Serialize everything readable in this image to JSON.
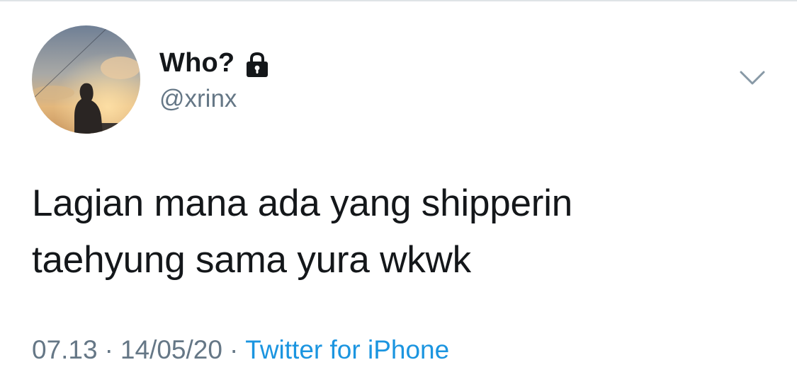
{
  "tweet": {
    "author": {
      "display_name": "Who?",
      "username": "@xrinx",
      "avatar_icon": "profile-photo-silhouette-sunset",
      "protected_icon": "lock-icon"
    },
    "text_line1": "Lagian mana ada yang shipperin",
    "text_line2": "taehyung sama yura wkwk",
    "time": "07.13",
    "date": "14/05/20",
    "separator": "·",
    "source": "Twitter for iPhone",
    "menu_icon": "chevron-down-icon"
  },
  "colors": {
    "text_primary": "#14171a",
    "text_secondary": "#657786",
    "link": "#1b95e0",
    "divider": "#dfe3e6"
  }
}
